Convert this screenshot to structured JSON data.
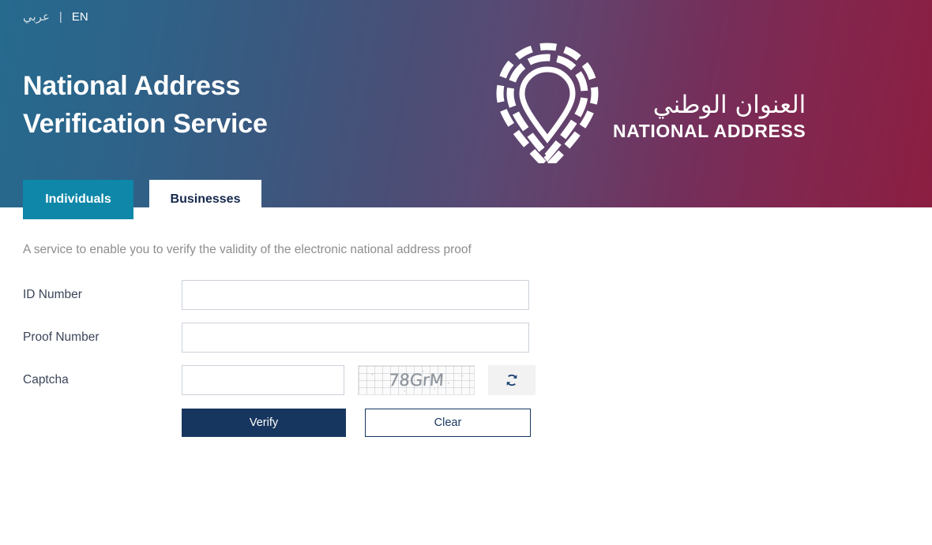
{
  "header": {
    "lang": {
      "arabic_label": "عربي",
      "separator": "|",
      "english_label": "EN"
    },
    "title_line1": "National Address",
    "title_line2": "Verification Service",
    "logo": {
      "mark_name": "national-address-pin-logo",
      "arabic_text": "العنوان الوطني",
      "english_text": "NATIONAL ADDRESS"
    },
    "colors": {
      "gradient_start": "#266a8e",
      "gradient_mid": "#574a74",
      "gradient_end": "#8b1e41"
    }
  },
  "tabs": [
    {
      "label": "Individuals",
      "active": true
    },
    {
      "label": "Businesses",
      "active": false
    }
  ],
  "main": {
    "service_description": "A service to enable you to verify the validity of the electronic national address proof",
    "form": {
      "id_number": {
        "label": "ID Number",
        "value": "",
        "placeholder": ""
      },
      "proof_number": {
        "label": "Proof Number",
        "value": "",
        "placeholder": ""
      },
      "captcha": {
        "label": "Captcha",
        "value": "",
        "placeholder": "",
        "image_text": "78GrM",
        "refresh_icon": "refresh-icon"
      }
    },
    "buttons": {
      "verify_label": "Verify",
      "clear_label": "Clear"
    }
  },
  "colors": {
    "tab_active": "#0e87a8",
    "tab_inactive_text": "#16294d",
    "primary_navy": "#17365f",
    "input_border": "#ccd2da",
    "description_text": "#8d8d8d"
  }
}
